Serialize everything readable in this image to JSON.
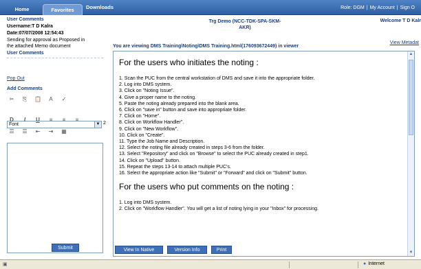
{
  "tabs": [
    "Home",
    "Favorites",
    "Downloads"
  ],
  "toplinks": {
    "role": "Role: DGM",
    "account": "My Account",
    "signout": "Sign O"
  },
  "left": {
    "user_comments_header": "User Comments",
    "username": "Username:T D Kalra",
    "date": "Date:07/07/2008 12:54:43",
    "comment_line1": "Sending for approval as Proposed in",
    "comment_line2": "the attached Memo document",
    "user_comments_header2": "User Comments",
    "popout": "Pop Out",
    "add_comments": "Add Comments",
    "font_value": "Font",
    "size_value": "2",
    "submit": "Submit"
  },
  "header": {
    "demo_line1": "Trg Demo (NCC-TDK-SPA-SKM-",
    "demo_line2": "AKR)",
    "welcome": "Welcome T D Kalr",
    "viewing": "You are viewing DMS Training\\Noting\\DMS Training.html(176093672449) in viewer",
    "view_meta": "View Metadat"
  },
  "doc": {
    "heading1": "For the users who initiates the noting :",
    "steps1": [
      "1. Scan the PUC from the central workstation of DMS and save it into the appropriate folder.",
      "2. Log into DMS system.",
      "3. Click on \"Noting Issue\".",
      "4. Give a proper name to the noting.",
      "5. Paste the noting already prepared into the blank area.",
      "6. Click on \"save in\" button and save into appropriate folder.",
      "7. Click on \"Home\".",
      "8. Click on Workflow Handler\".",
      "9. Click on \"New Workflow\".",
      "10. Click on \"Create\".",
      "11. Type the Job Name and Description.",
      "12. Select the noting file already created in steps 3-6 from the folder.",
      "13. Select \"Repository\" and click on \"Browse\" to select the PUC already created in step1.",
      "14. Click on \"Upload\" button.",
      "15. Repeat the steps 13-14 to attach multiple PUC's.",
      "16. Select the appropriate action like \"Submit\" or \"Forward\" and click on \"Submit\" button."
    ],
    "heading2": "For the users who put comments on the noting :",
    "steps2": [
      "1. Log into DMS system.",
      "2. Click on \"Workflow Handler\". You will get a list of noting lying in your \"Inbox\" for processing."
    ]
  },
  "buttons": {
    "view_native": "View In Native",
    "version_info": "Version Info",
    "print": "Print"
  },
  "status": {
    "zone": "Internet"
  },
  "colors": {
    "accent": "#2e5ea3",
    "link": "#1a3d7c"
  }
}
